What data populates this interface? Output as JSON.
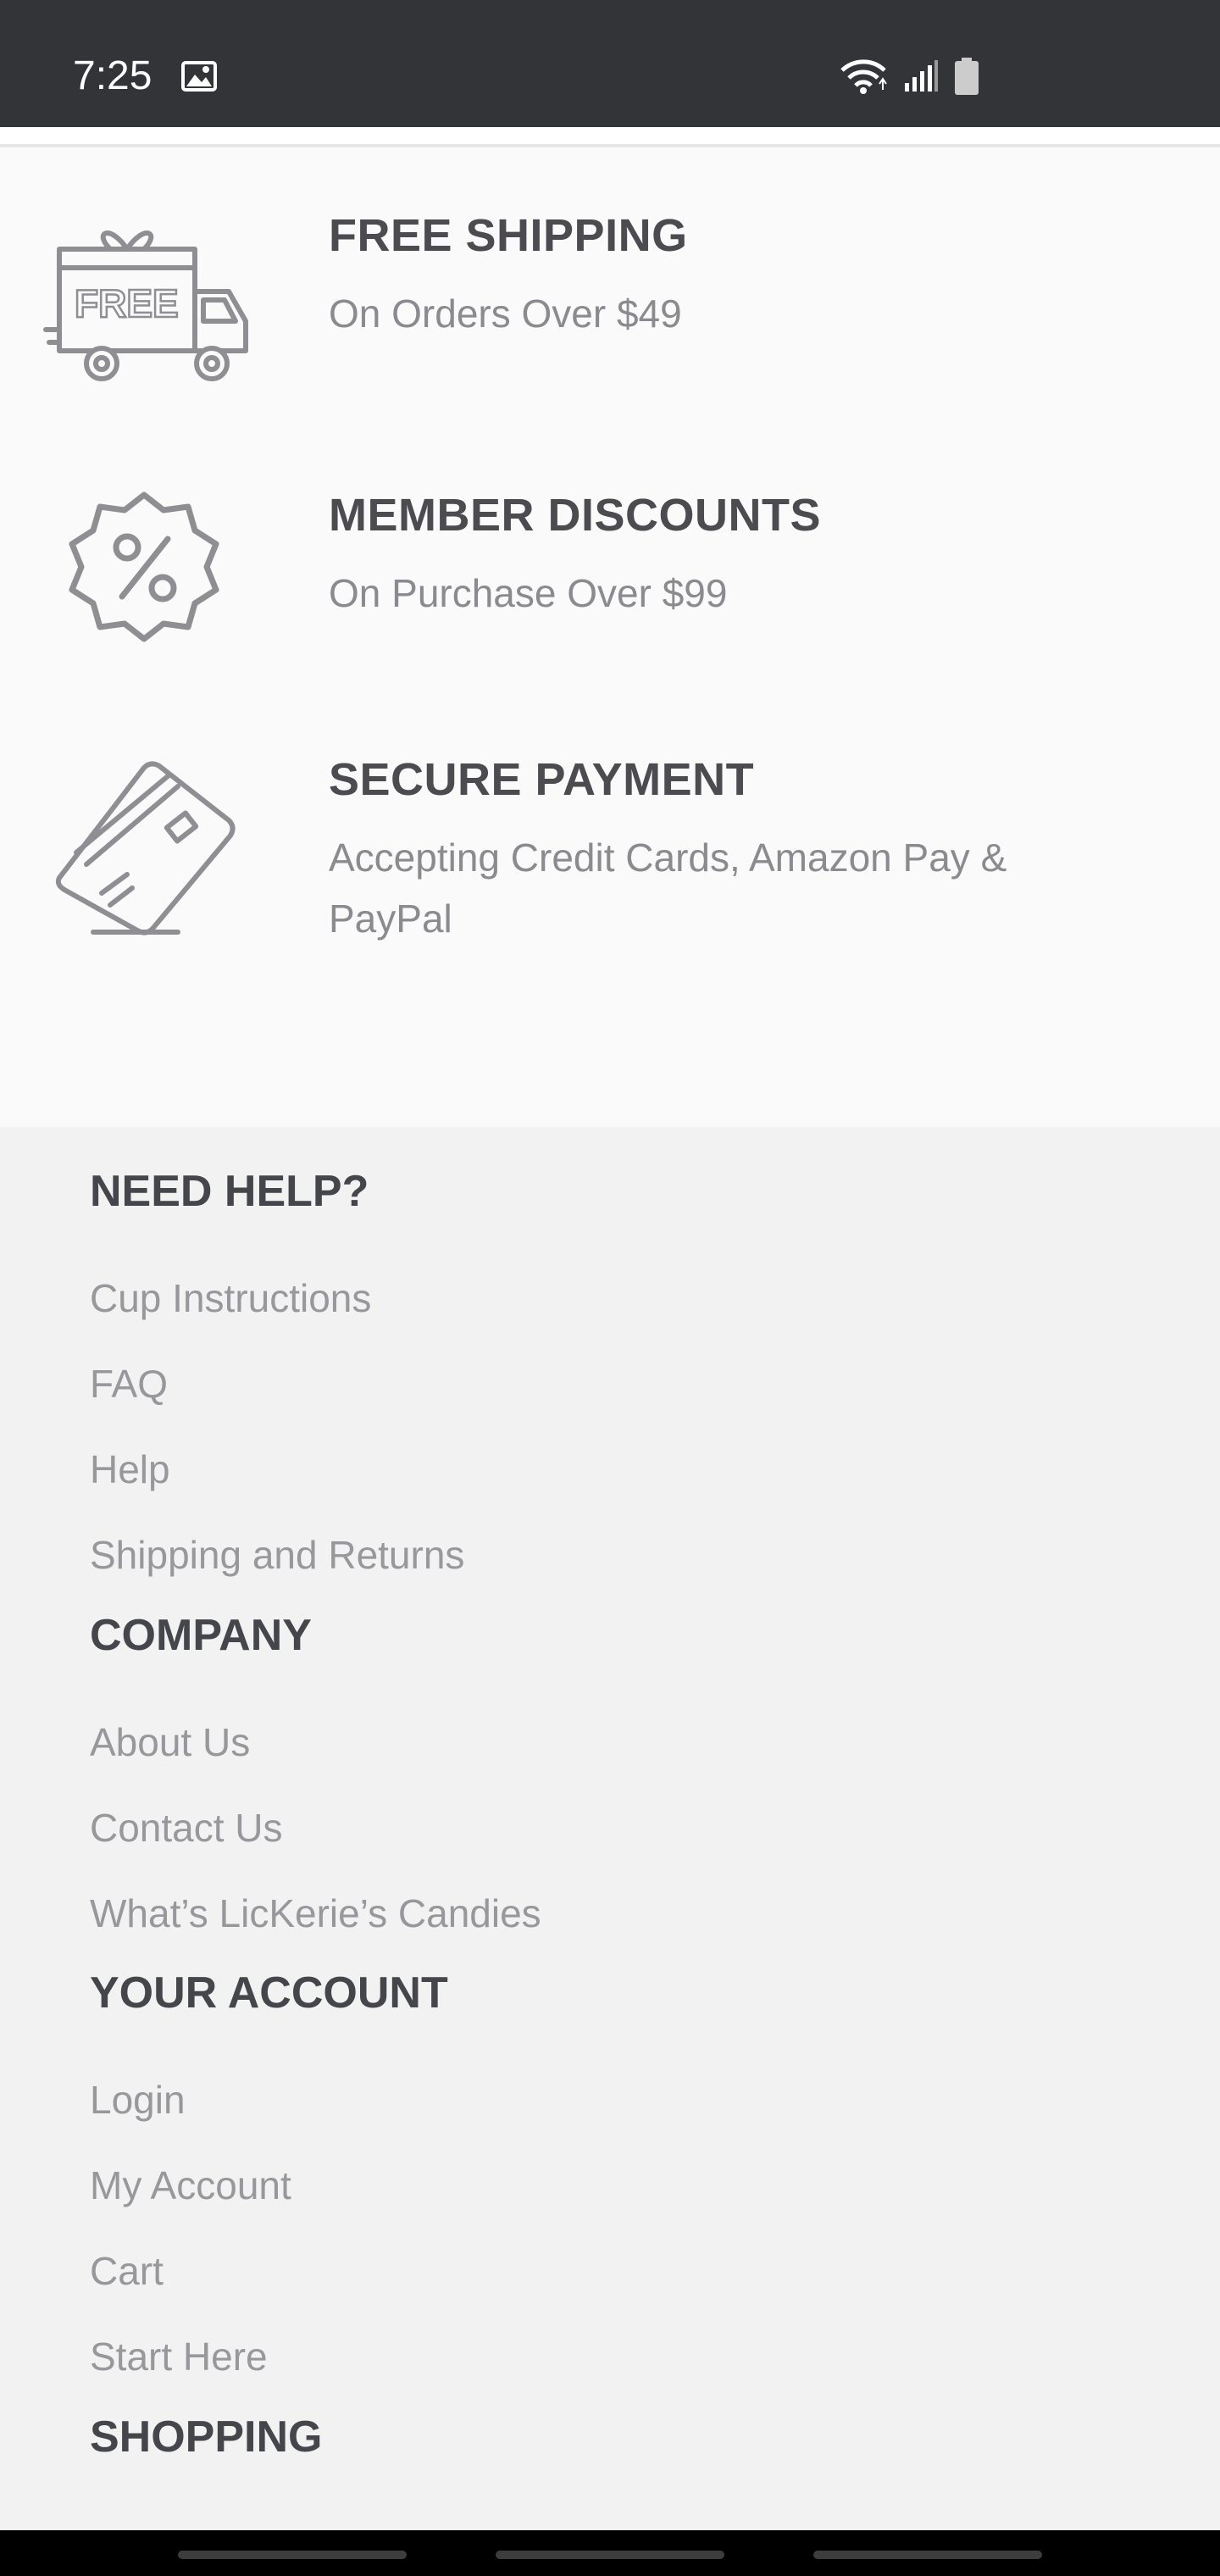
{
  "status_bar": {
    "time": "7:25",
    "icons": [
      "image-icon",
      "wifi-icon",
      "signal-icon",
      "battery-icon"
    ]
  },
  "features": [
    {
      "icon": "free-delivery-truck-icon",
      "icon_text": "FREE",
      "title": "FREE SHIPPING",
      "subtitle": "On Orders Over $49"
    },
    {
      "icon": "percent-badge-icon",
      "title": "MEMBER DISCOUNTS",
      "subtitle": "On Purchase Over $99"
    },
    {
      "icon": "credit-card-icon",
      "title": "SECURE PAYMENT",
      "subtitle": "Accepting Credit Cards, Amazon Pay & PayPal"
    }
  ],
  "footer": {
    "need_help": {
      "heading": "NEED HELP?",
      "links": [
        "Cup Instructions",
        "FAQ",
        "Help",
        "Shipping and Returns"
      ]
    },
    "company": {
      "heading": "COMPANY",
      "links": [
        "About Us",
        "Contact Us",
        "What’s LicKerie’s Candies"
      ]
    },
    "your_account": {
      "heading": "YOUR ACCOUNT",
      "links": [
        "Login",
        "My Account",
        "Cart",
        "Start Here"
      ]
    },
    "shopping": {
      "heading": "SHOPPING"
    }
  },
  "colors": {
    "status_bar": "#333438",
    "features_bg": "#fafafa",
    "footer_bg": "#f2f2f2",
    "heading": "#45464b",
    "link": "#98989c",
    "icon": "#8e8e93"
  }
}
